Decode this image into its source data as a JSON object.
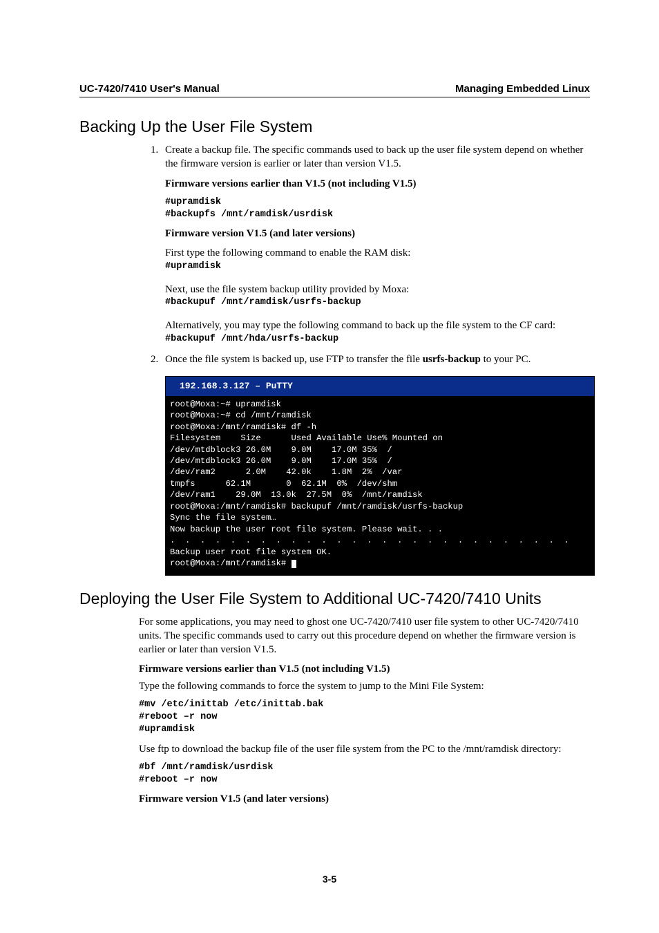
{
  "header": {
    "left": "UC-7420/7410 User's Manual",
    "right": "Managing Embedded Linux"
  },
  "section1": {
    "title": "Backing Up the User File System",
    "step1_intro": "Create a backup file. The specific commands used to back up the user file system depend on whether the firmware version is earlier or later than version V1.5.",
    "fw_earlier_heading": "Firmware versions earlier than V1.5 (not including V1.5)",
    "cmds_earlier": "#upramdisk\n#backupfs /mnt/ramdisk/usrdisk",
    "fw_later_heading": "Firmware version V1.5 (and later versions)",
    "later_line1": "First type the following command to enable the RAM disk:",
    "later_cmd1": "#upramdisk",
    "later_line2": "Next, use the file system backup utility provided by Moxa:",
    "later_cmd2": "#backupuf /mnt/ramdisk/usrfs-backup",
    "later_line3": "Alternatively, you may type the following command to back up the file system to the CF card:",
    "later_cmd3": "#backupuf /mnt/hda/usrfs-backup",
    "step2_pre": "Once the file system is backed up, use FTP to transfer the file ",
    "step2_file": "usrfs-backup",
    "step2_post": " to your PC."
  },
  "terminal": {
    "title": "  192.168.3.127 – PuTTY",
    "body": "root@Moxa:~# upramdisk\nroot@Moxa:~# cd /mnt/ramdisk\nroot@Moxa:/mnt/ramdisk# df -h\nFilesystem    Size      Used Available Use% Mounted on\n/dev/mtdblock3 26.0M    9.0M    17.0M 35%  /\n/dev/mtdblock3 26.0M    9.0M    17.0M 35%  /\n/dev/ram2      2.0M    42.0k    1.8M  2%  /var\ntmpfs      62.1M       0  62.1M  0%  /dev/shm\n/dev/ram1    29.0M  13.0k  27.5M  0%  /mnt/ramdisk\nroot@Moxa:/mnt/ramdisk# backupuf /mnt/ramdisk/usrfs-backup\nSync the file system…\nNow backup the user root file system. Please wait. . .\n.  .  .  .  .  .  .  .  .  .  .  .  .  .  .  .  .  .  .  .  .  .  .  .  .  .  .\nBackup user root file system OK.\nroot@Moxa:/mnt/ramdisk# "
  },
  "section2": {
    "title": "Deploying the User File System to Additional UC-7420/7410 Units",
    "intro": "For some applications, you may need to ghost one UC-7420/7410 user file system to other UC-7420/7410 units. The specific commands used to carry out this procedure depend on whether the firmware version is earlier or later than version V1.5.",
    "fw_earlier_heading": "Firmware versions earlier than V1.5 (not including V1.5)",
    "earlier_text": "Type the following commands to force the system to jump to the Mini File System:",
    "earlier_cmds": "#mv /etc/inittab /etc/inittab.bak\n#reboot –r now\n#upramdisk",
    "ftp_text": "Use ftp to download the backup file of the user file system from the PC to the /mnt/ramdisk directory:",
    "ftp_cmds": "#bf /mnt/ramdisk/usrdisk\n#reboot –r now",
    "fw_later_heading": "Firmware version V1.5 (and later versions)"
  },
  "chart_data": {
    "type": "table",
    "title": "df -h output",
    "columns": [
      "Filesystem",
      "Size",
      "Used",
      "Available",
      "Use%",
      "Mounted on"
    ],
    "rows": [
      [
        "/dev/mtdblock3",
        "26.0M",
        "9.0M",
        "17.0M",
        "35%",
        "/"
      ],
      [
        "/dev/mtdblock3",
        "26.0M",
        "9.0M",
        "17.0M",
        "35%",
        "/"
      ],
      [
        "/dev/ram2",
        "2.0M",
        "42.0k",
        "1.8M",
        "2%",
        "/var"
      ],
      [
        "tmpfs",
        "62.1M",
        "0",
        "62.1M",
        "0%",
        "/dev/shm"
      ],
      [
        "/dev/ram1",
        "29.0M",
        "13.0k",
        "27.5M",
        "0%",
        "/mnt/ramdisk"
      ]
    ]
  },
  "footer": {
    "page": "3-5"
  }
}
